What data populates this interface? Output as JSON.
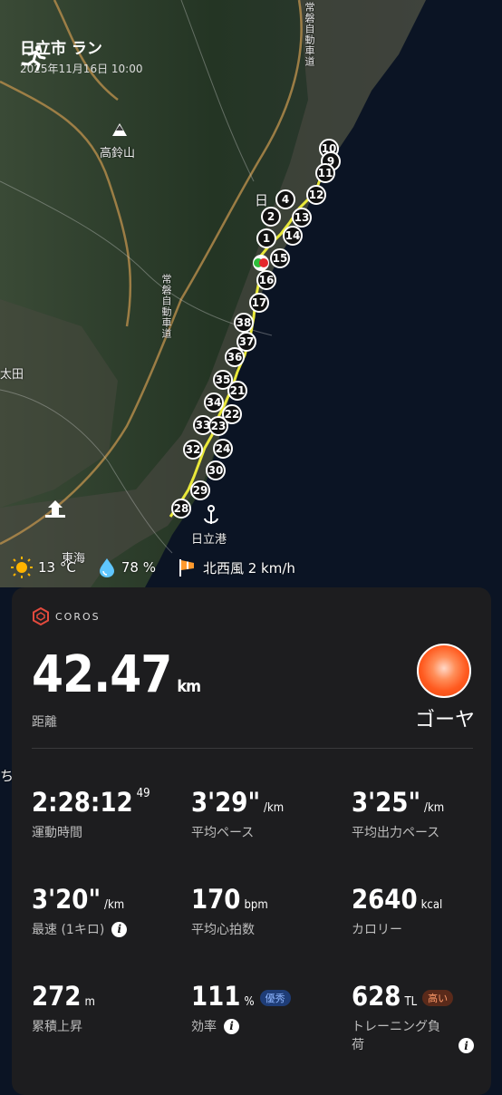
{
  "header": {
    "title": "日立市 ラン",
    "date": "2025年11月16日 10:00"
  },
  "map": {
    "places": {
      "mountain": "高鈴山",
      "city_left": "太田",
      "port": "日立港",
      "city_top": "日",
      "tokai": "東海",
      "left_edge": "ち"
    },
    "roads": {
      "expressway_top": "常磐自動車道",
      "expressway_mid": "常磐自動車道"
    },
    "markers": [
      "10",
      "9",
      "11",
      "12",
      "4",
      "13",
      "2",
      "14",
      "1",
      "15",
      "16",
      "17",
      "38",
      "37",
      "36",
      "35",
      "21",
      "34",
      "22",
      "33",
      "23",
      "32",
      "24",
      "30",
      "29",
      "28"
    ],
    "colors": {
      "route": "#e9e83a",
      "ocean": "#0b1424",
      "land": "#2b3a2a"
    }
  },
  "weather": {
    "temp": "13 °C",
    "humidity": "78 %",
    "wind": "北西風 2 km/h"
  },
  "card": {
    "brand": "COROS",
    "distance": {
      "value": "42.47",
      "unit": "km",
      "label": "距離"
    },
    "athlete": "ゴーヤ",
    "stats": {
      "time": {
        "value": "2:28:12",
        "sup": "49",
        "label": "運動時間"
      },
      "avg_pace": {
        "value": "3'29\"",
        "unit": "/km",
        "label": "平均ペース"
      },
      "avg_power_pace": {
        "value": "3'25\"",
        "unit": "/km",
        "label": "平均出力ペース"
      },
      "fastest": {
        "value": "3'20\"",
        "unit": "/km",
        "label": "最速 (1キロ)"
      },
      "heart_rate": {
        "value": "170",
        "unit": "bpm",
        "label": "平均心拍数"
      },
      "calories": {
        "value": "2640",
        "unit": "kcal",
        "label": "カロリー"
      },
      "ascent": {
        "value": "272",
        "unit": "m",
        "label": "累積上昇"
      },
      "efficiency": {
        "value": "111",
        "unit": "%",
        "badge": "優秀",
        "label": "効率"
      },
      "training_load": {
        "value": "628",
        "unit": "TL",
        "badge": "高い",
        "label": "トレーニング負荷"
      }
    }
  }
}
